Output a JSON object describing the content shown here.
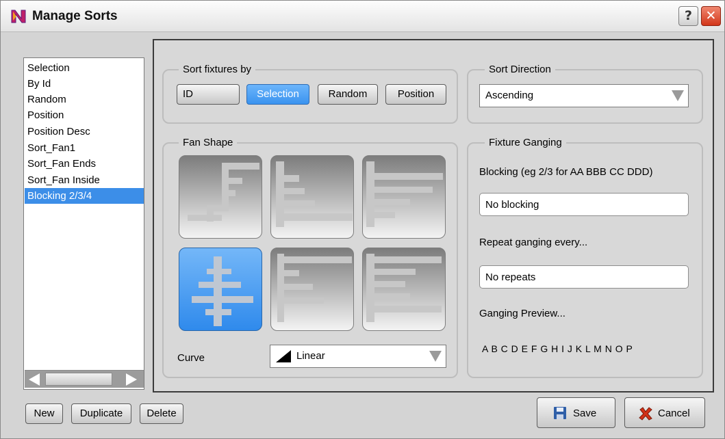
{
  "window": {
    "title": "Manage Sorts",
    "help_label": "?",
    "close_label": "✕",
    "accent_color": "#3c8ee8"
  },
  "sort_list": {
    "items": [
      "Selection",
      "By Id",
      "Random",
      "Position",
      "Position Desc",
      "Sort_Fan1",
      "Sort_Fan Ends",
      "Sort_Fan Inside",
      "Blocking 2/3/4"
    ],
    "selected": "Blocking 2/3/4"
  },
  "sort_fixtures": {
    "title": "Sort fixtures by",
    "buttons": [
      "ID",
      "Selection",
      "Random",
      "Position"
    ],
    "active": "Selection"
  },
  "sort_direction": {
    "title": "Sort Direction",
    "value": "Ascending"
  },
  "fan_shape": {
    "title": "Fan Shape",
    "tiles": [
      "fan-shape-1",
      "fan-shape-2",
      "fan-shape-3",
      "fan-shape-4",
      "fan-shape-5",
      "fan-shape-6"
    ],
    "active": "fan-shape-4",
    "curve_label": "Curve",
    "curve_value": "Linear"
  },
  "fixture_ganging": {
    "title": "Fixture Ganging",
    "blocking_label": "Blocking (eg 2/3 for AA BBB CC DDD)",
    "blocking_value": "No blocking",
    "repeat_label": "Repeat ganging every...",
    "repeat_value": "No repeats",
    "preview_label": "Ganging Preview...",
    "preview_value": "A B C D E F G H I J K L M N O P"
  },
  "footer": {
    "new_label": "New",
    "duplicate_label": "Duplicate",
    "delete_label": "Delete",
    "save_label": "Save",
    "cancel_label": "Cancel"
  }
}
